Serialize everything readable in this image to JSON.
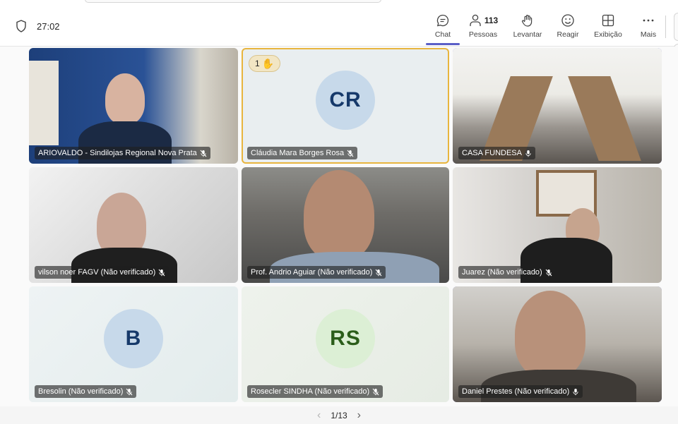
{
  "toolbar": {
    "timer": "27:02",
    "items": [
      {
        "label": "Chat",
        "icon": "chat-icon"
      },
      {
        "label": "Pessoas",
        "count": "113",
        "icon": "people-icon"
      },
      {
        "label": "Levantar",
        "icon": "raise-hand-icon"
      },
      {
        "label": "Reagir",
        "icon": "smiley-icon"
      },
      {
        "label": "Exibição",
        "icon": "layout-grid-icon"
      },
      {
        "label": "Mais",
        "icon": "more-icon"
      }
    ]
  },
  "tiles": [
    {
      "name": "ARIOVALDO - Sindilojas Regional Nova Prata",
      "mic": "muted",
      "video": true
    },
    {
      "name": "Cláudia Mara Borges Rosa",
      "mic": "muted",
      "initials": "CR",
      "raised_hand_order": "1"
    },
    {
      "name": "CASA FUNDESA",
      "mic": "on",
      "video": true
    },
    {
      "name": "vilson noer FAGV (Não verificado)",
      "mic": "muted",
      "video": true
    },
    {
      "name": "Prof. Andrio Aguiar (Não verificado)",
      "mic": "muted",
      "video": true
    },
    {
      "name": "Juarez (Não verificado)",
      "mic": "muted",
      "video": true
    },
    {
      "name": "Bresolin (Não verificado)",
      "mic": "muted",
      "initials": "B"
    },
    {
      "name": "Rosecler SINDHA (Não verificado)",
      "mic": "muted",
      "initials": "RS"
    },
    {
      "name": "Daniel Prestes (Não verificado)",
      "mic": "on",
      "video": true
    }
  ],
  "pager": {
    "current": "1/13",
    "prev": "‹",
    "next": "›"
  },
  "colors": {
    "accent": "#5b5fc7",
    "speaking_border": "#7174c8",
    "raised_hand_border": "#e8b53e"
  }
}
